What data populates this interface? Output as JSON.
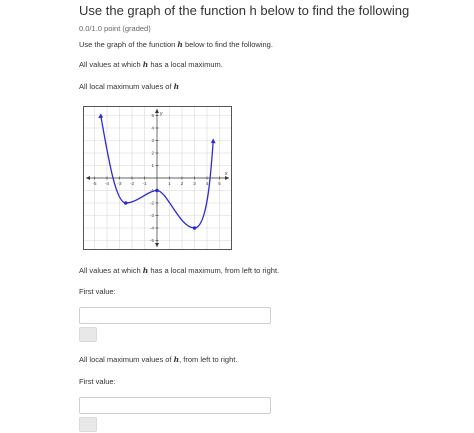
{
  "header": {
    "title": "Use the graph of the function h below to find the following",
    "points": "0.0/1.0 point (graded)"
  },
  "intro": {
    "pre": "Use the graph of the function ",
    "var": "h",
    "post": " below to find the following."
  },
  "prompt1": {
    "pre": "All values at which ",
    "var": "h",
    "post": " has a local maximum."
  },
  "prompt2": {
    "pre": "All local maximum values of ",
    "var": "h",
    "post": ""
  },
  "question1": {
    "pre": "All values at which ",
    "var": "h",
    "post": " has a local maximum, from left to right."
  },
  "question1_field_label": "First value:",
  "question2": {
    "pre": "All local maximum values of ",
    "var": "h",
    "post": ", from left to right."
  },
  "question2_field_label": "First value:",
  "graph": {
    "x_label": "x",
    "y_label": "y",
    "x_ticks": [
      "-5",
      "-4",
      "-3",
      "-2",
      "-1",
      "1",
      "2",
      "3",
      "4",
      "5"
    ],
    "y_ticks": [
      "5",
      "4",
      "3",
      "2",
      "1",
      "-1",
      "-2",
      "-3",
      "-4",
      "-5"
    ],
    "x_range": [
      -5.5,
      5.5
    ],
    "y_range": [
      -5.5,
      5.5
    ],
    "curve_color": "#2b2bd6",
    "curve_points": [
      [
        -4.5,
        5
      ],
      [
        -2.5,
        -2
      ],
      [
        0,
        -1
      ],
      [
        3,
        -4
      ],
      [
        4.5,
        3
      ]
    ],
    "marked_points": [
      [
        -2.5,
        -2
      ],
      [
        0,
        -1
      ],
      [
        3,
        -4
      ]
    ],
    "arrows": [
      "up-left",
      "up-right"
    ]
  }
}
